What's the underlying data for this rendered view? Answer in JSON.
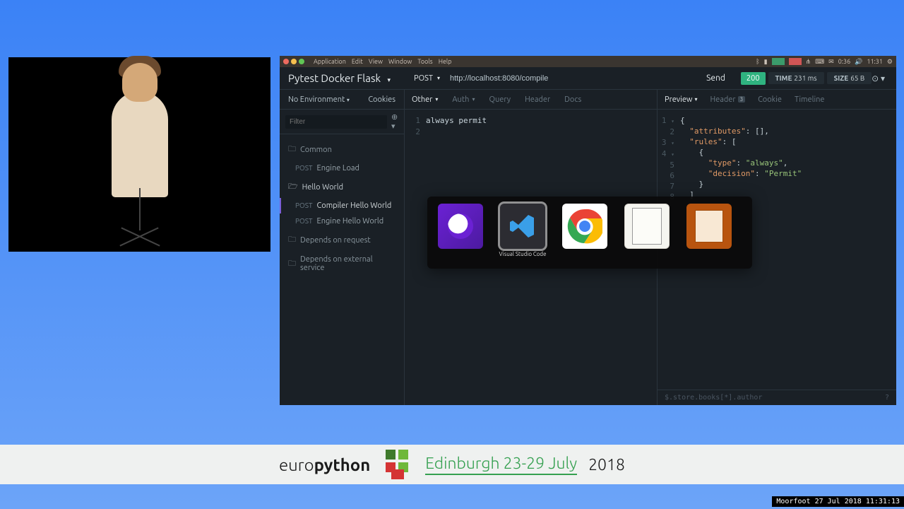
{
  "menubar": {
    "app": "Application",
    "items": [
      "Edit",
      "View",
      "Window",
      "Tools",
      "Help"
    ],
    "time": "11:31",
    "vol": "0:36"
  },
  "workspace": {
    "title": "Pytest Docker Flask"
  },
  "request": {
    "method": "POST",
    "url": "http://localhost:8080/compile",
    "send": "Send"
  },
  "response": {
    "status": "200",
    "time_label": "TIME",
    "time_value": "231 ms",
    "size_label": "SIZE",
    "size_value": "65 B"
  },
  "sidebar_top": {
    "env": "No Environment",
    "cookies": "Cookies",
    "filter_placeholder": "Filter"
  },
  "tree": {
    "folders": [
      {
        "name": "Common",
        "open": false,
        "items": [
          {
            "verb": "POST",
            "label": "Engine Load"
          }
        ]
      },
      {
        "name": "Hello World",
        "open": true,
        "items": [
          {
            "verb": "POST",
            "label": "Compiler Hello World",
            "selected": true
          },
          {
            "verb": "POST",
            "label": "Engine Hello World"
          }
        ]
      },
      {
        "name": "Depends on request",
        "open": false,
        "items": []
      },
      {
        "name": "Depends on external service",
        "open": false,
        "items": []
      }
    ]
  },
  "req_tabs": {
    "items": [
      "Other",
      "Auth",
      "Query",
      "Header",
      "Docs"
    ],
    "active": "Other"
  },
  "resp_tabs": {
    "items": [
      "Preview",
      "Header",
      "Cookie",
      "Timeline"
    ],
    "header_count": "3",
    "active": "Preview"
  },
  "req_body": {
    "lines": [
      "always permit",
      ""
    ]
  },
  "resp_body": {
    "lines": [
      {
        "n": 1,
        "tri": "▾",
        "t": [
          {
            "c": "p",
            "v": "{"
          }
        ]
      },
      {
        "n": 2,
        "t": [
          {
            "c": "p",
            "v": "  "
          },
          {
            "c": "k",
            "v": "\"attributes\""
          },
          {
            "c": "p",
            "v": ": [],"
          }
        ]
      },
      {
        "n": 3,
        "tri": "▾",
        "t": [
          {
            "c": "p",
            "v": "  "
          },
          {
            "c": "k",
            "v": "\"rules\""
          },
          {
            "c": "p",
            "v": ": ["
          }
        ]
      },
      {
        "n": 4,
        "tri": "▾",
        "t": [
          {
            "c": "p",
            "v": "    {"
          }
        ]
      },
      {
        "n": 5,
        "t": [
          {
            "c": "p",
            "v": "      "
          },
          {
            "c": "k",
            "v": "\"type\""
          },
          {
            "c": "p",
            "v": ": "
          },
          {
            "c": "s",
            "v": "\"always\""
          },
          {
            "c": "p",
            "v": ","
          }
        ]
      },
      {
        "n": 6,
        "t": [
          {
            "c": "p",
            "v": "      "
          },
          {
            "c": "k",
            "v": "\"decision\""
          },
          {
            "c": "p",
            "v": ": "
          },
          {
            "c": "s",
            "v": "\"Permit\""
          }
        ]
      },
      {
        "n": 7,
        "t": [
          {
            "c": "p",
            "v": "    }"
          }
        ]
      },
      {
        "n": 8,
        "t": [
          {
            "c": "p",
            "v": "  ]"
          }
        ]
      }
    ]
  },
  "footer_path": "$.store.books[*].author",
  "switcher": {
    "apps": [
      {
        "id": "insomnia",
        "label": "Insomnia"
      },
      {
        "id": "vscode",
        "label": "Visual Studio Code",
        "selected": true
      },
      {
        "id": "chrome",
        "label": "Google Chrome"
      },
      {
        "id": "libre",
        "label": "LibreOffice"
      },
      {
        "id": "impress",
        "label": "LibreOffice Impress"
      }
    ]
  },
  "banner": {
    "euro1": "euro",
    "euro2": "python",
    "ed": "Edinburgh 23-29 July",
    "yr": "2018"
  },
  "timestamp": "Moorfoot 27 Jul 2018 11:31:13"
}
